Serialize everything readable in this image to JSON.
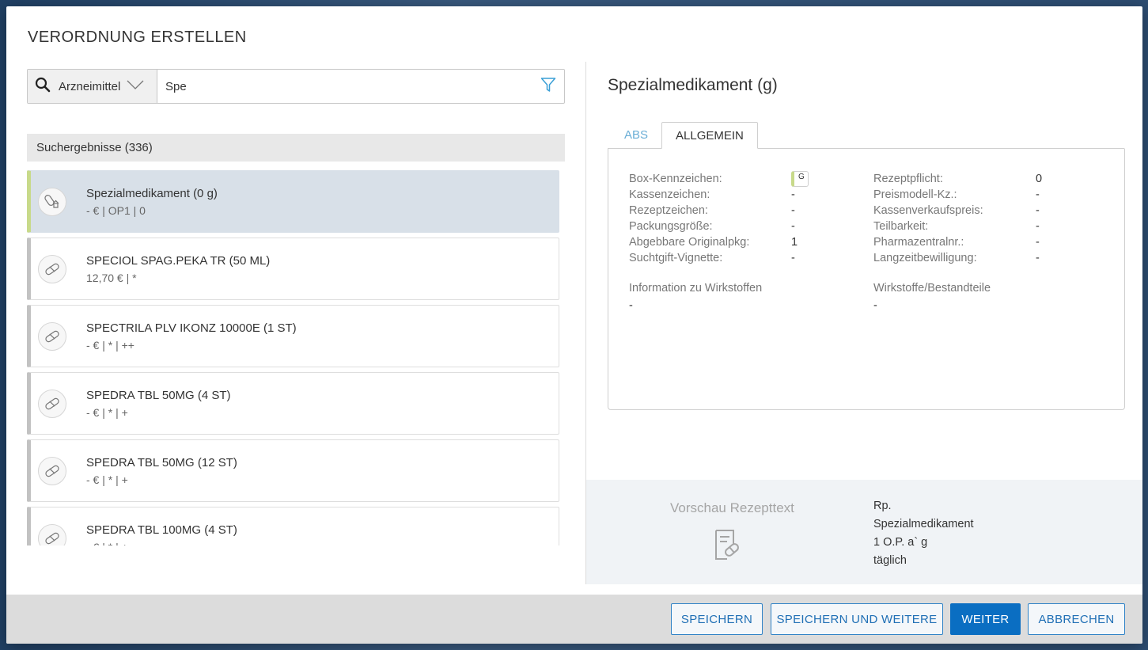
{
  "dialog": {
    "title": "VERORDNUNG ERSTELLEN"
  },
  "search": {
    "type_label": "Arzneimittel",
    "value": "Spe",
    "icon": "search-icon",
    "filter_icon": "filter-icon"
  },
  "results": {
    "header": "Suchergebnisse (336)",
    "items": [
      {
        "name": "Spezialmedikament (0 g)",
        "sub": "- € | OP1 | 0",
        "selected": true,
        "icon": "custom-drug-icon"
      },
      {
        "name": "SPECIOL SPAG.PEKA TR (50 ML)",
        "sub": "12,70 € | *",
        "icon": "pill-icon"
      },
      {
        "name": "SPECTRILA PLV IKONZ 10000E (1 ST)",
        "sub": "- € | * | ++",
        "icon": "pill-icon"
      },
      {
        "name": "SPEDRA TBL 50MG (4 ST)",
        "sub": "- € | * | +",
        "icon": "pill-icon"
      },
      {
        "name": "SPEDRA TBL 50MG (12 ST)",
        "sub": "- € | * | +",
        "icon": "pill-icon"
      },
      {
        "name": "SPEDRA TBL 100MG (4 ST)",
        "sub": "- € | * | +",
        "icon": "pill-icon"
      }
    ]
  },
  "detail": {
    "title": "Spezialmedikament (g)",
    "tabs": {
      "abs": "ABS",
      "allgemein": "ALLGEMEIN"
    },
    "fields_left": [
      {
        "label": "Box-Kennzeichen:",
        "value": "G"
      },
      {
        "label": "Kassenzeichen:",
        "value": "-"
      },
      {
        "label": "Rezeptzeichen:",
        "value": "-"
      },
      {
        "label": "Packungsgröße:",
        "value": "-"
      },
      {
        "label": "Abgebbare Originalpkg:",
        "value": "1"
      },
      {
        "label": "Suchtgift-Vignette:",
        "value": "-"
      }
    ],
    "fields_right": [
      {
        "label": "Rezeptpflicht:",
        "value": "0"
      },
      {
        "label": "Preismodell-Kz.:",
        "value": "-"
      },
      {
        "label": "Kassenverkaufspreis:",
        "value": "-"
      },
      {
        "label": "Teilbarkeit:",
        "value": "-"
      },
      {
        "label": "Pharmazentralnr.:",
        "value": "-"
      },
      {
        "label": "Langzeitbewilligung:",
        "value": "-"
      }
    ],
    "info_wirkstoffe": {
      "title": "Information zu Wirkstoffen",
      "value": "-"
    },
    "wirkstoffe_bestandteile": {
      "title": "Wirkstoffe/Bestandteile",
      "value": "-"
    }
  },
  "preview": {
    "title": "Vorschau Rezepttext",
    "lines": [
      "Rp.",
      "Spezialmedikament",
      "1 O.P. a` g",
      "täglich"
    ]
  },
  "footer": {
    "save": "SPEICHERN",
    "save_more": "SPEICHERN UND WEITERE",
    "next": "WEITER",
    "cancel": "ABBRECHEN"
  },
  "colors": {
    "primary": "#0a6ec2",
    "accent_tab": "#6aaed6",
    "selected_bg": "#d8e0e8",
    "selected_marker": "#c8da8a"
  }
}
